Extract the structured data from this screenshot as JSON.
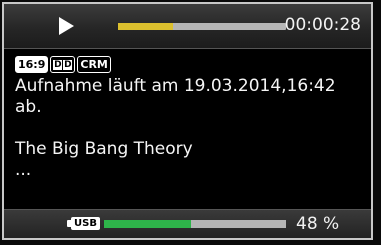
{
  "playback": {
    "state_icon": "play-icon",
    "progress_fraction": 0.33,
    "progress_color": "#dcc02e",
    "elapsed_time": "00:00:28"
  },
  "badges": {
    "aspect": "16:9",
    "audio": "DD",
    "crm": "CRM"
  },
  "info": {
    "line1": "Aufnahme läuft am 19.03.2014,16:42",
    "line2": "ab.",
    "title": "The Big Bang Theory",
    "more": "..."
  },
  "storage": {
    "device_icon": "usb-icon",
    "device_label": "USB",
    "used_fraction": 0.48,
    "used_color": "#2eb44a",
    "used_text": "48 %"
  }
}
